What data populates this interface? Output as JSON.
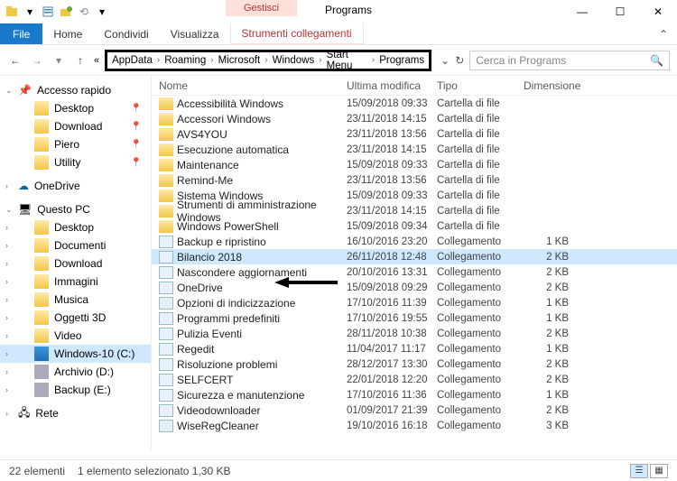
{
  "window": {
    "manage_label": "Gestisci",
    "title": "Programs"
  },
  "ribbon": {
    "file": "File",
    "home": "Home",
    "share": "Condividi",
    "view": "Visualizza",
    "tools": "Strumenti collegamenti"
  },
  "breadcrumb": {
    "parts": [
      "AppData",
      "Roaming",
      "Microsoft",
      "Windows",
      "Start Menu",
      "Programs"
    ]
  },
  "search": {
    "placeholder": "Cerca in Programs"
  },
  "sidebar": {
    "quick": {
      "label": "Accesso rapido",
      "items": [
        {
          "label": "Desktop",
          "pinned": true
        },
        {
          "label": "Download",
          "pinned": true
        },
        {
          "label": "Piero",
          "pinned": true
        },
        {
          "label": "Utility",
          "pinned": true
        }
      ]
    },
    "onedrive": {
      "label": "OneDrive"
    },
    "thispc": {
      "label": "Questo PC",
      "items": [
        {
          "label": "Desktop"
        },
        {
          "label": "Documenti"
        },
        {
          "label": "Download"
        },
        {
          "label": "Immagini"
        },
        {
          "label": "Musica"
        },
        {
          "label": "Oggetti 3D"
        },
        {
          "label": "Video"
        },
        {
          "label": "Windows-10 (C:)",
          "selected": true,
          "drive": true
        },
        {
          "label": "Archivio (D:)",
          "drive": true
        },
        {
          "label": "Backup (E:)",
          "drive": true
        }
      ]
    },
    "network": {
      "label": "Rete"
    }
  },
  "columns": {
    "name": "Nome",
    "date": "Ultima modifica",
    "type": "Tipo",
    "size": "Dimensione"
  },
  "files": [
    {
      "name": "Accessibilità Windows",
      "date": "15/09/2018 09:33",
      "type": "Cartella di file",
      "size": "",
      "folder": true
    },
    {
      "name": "Accessori Windows",
      "date": "23/11/2018 14:15",
      "type": "Cartella di file",
      "size": "",
      "folder": true
    },
    {
      "name": "AVS4YOU",
      "date": "23/11/2018 13:56",
      "type": "Cartella di file",
      "size": "",
      "folder": true
    },
    {
      "name": "Esecuzione automatica",
      "date": "23/11/2018 14:15",
      "type": "Cartella di file",
      "size": "",
      "folder": true
    },
    {
      "name": "Maintenance",
      "date": "15/09/2018 09:33",
      "type": "Cartella di file",
      "size": "",
      "folder": true
    },
    {
      "name": "Remind-Me",
      "date": "23/11/2018 13:56",
      "type": "Cartella di file",
      "size": "",
      "folder": true
    },
    {
      "name": "Sistema Windows",
      "date": "15/09/2018 09:33",
      "type": "Cartella di file",
      "size": "",
      "folder": true
    },
    {
      "name": "Strumenti di amministrazione Windows",
      "date": "23/11/2018 14:15",
      "type": "Cartella di file",
      "size": "",
      "folder": true
    },
    {
      "name": "Windows PowerShell",
      "date": "15/09/2018 09:34",
      "type": "Cartella di file",
      "size": "",
      "folder": true
    },
    {
      "name": "Backup e ripristino",
      "date": "16/10/2016 23:20",
      "type": "Collegamento",
      "size": "1 KB"
    },
    {
      "name": "Bilancio 2018",
      "date": "26/11/2018 12:48",
      "type": "Collegamento",
      "size": "2 KB",
      "selected": true
    },
    {
      "name": "Nascondere aggiornamenti",
      "date": "20/10/2016 13:31",
      "type": "Collegamento",
      "size": "2 KB"
    },
    {
      "name": "OneDrive",
      "date": "15/09/2018 09:29",
      "type": "Collegamento",
      "size": "2 KB"
    },
    {
      "name": "Opzioni di indicizzazione",
      "date": "17/10/2016 11:39",
      "type": "Collegamento",
      "size": "1 KB"
    },
    {
      "name": "Programmi predefiniti",
      "date": "17/10/2016 19:55",
      "type": "Collegamento",
      "size": "1 KB"
    },
    {
      "name": "Pulizia Eventi",
      "date": "28/11/2018 10:38",
      "type": "Collegamento",
      "size": "2 KB"
    },
    {
      "name": "Regedit",
      "date": "11/04/2017 11:17",
      "type": "Collegamento",
      "size": "1 KB"
    },
    {
      "name": "Risoluzione problemi",
      "date": "28/12/2017 13:30",
      "type": "Collegamento",
      "size": "2 KB"
    },
    {
      "name": "SELFCERT",
      "date": "22/01/2018 12:20",
      "type": "Collegamento",
      "size": "2 KB"
    },
    {
      "name": "Sicurezza e manutenzione",
      "date": "17/10/2016 11:36",
      "type": "Collegamento",
      "size": "1 KB"
    },
    {
      "name": "Videodownloader",
      "date": "01/09/2017 21:39",
      "type": "Collegamento",
      "size": "2 KB"
    },
    {
      "name": "WiseRegCleaner",
      "date": "19/10/2016 16:18",
      "type": "Collegamento",
      "size": "3 KB"
    }
  ],
  "status": {
    "count": "22 elementi",
    "selection": "1 elemento selezionato  1,30 KB"
  }
}
